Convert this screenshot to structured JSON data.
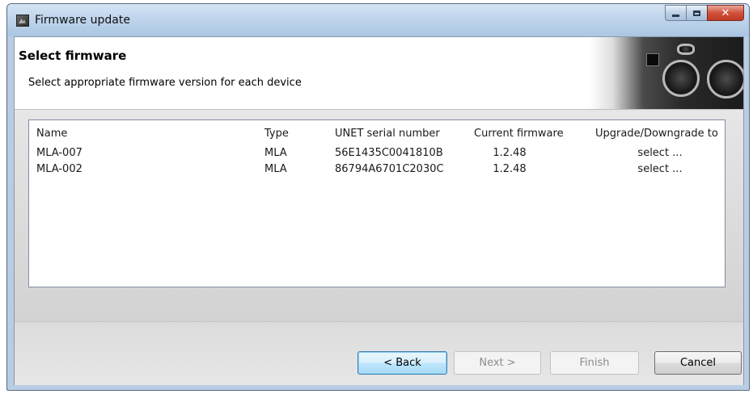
{
  "window": {
    "title": "Firmware update"
  },
  "header": {
    "title": "Select firmware",
    "subtitle": "Select appropriate firmware version for each device"
  },
  "device_list": {
    "columns": [
      "Name",
      "Type",
      "UNET serial number",
      "Current firmware",
      "Upgrade/Downgrade to"
    ],
    "rows": [
      {
        "name": "MLA-007",
        "type": "MLA",
        "serial": "56E1435C0041810B",
        "current": "1.2.48",
        "upgrade": "select ..."
      },
      {
        "name": "MLA-002",
        "type": "MLA",
        "serial": "86794A6701C2030C",
        "current": "1.2.48",
        "upgrade": "select ..."
      }
    ]
  },
  "buttons": {
    "back": "< Back",
    "next": "Next >",
    "finish": "Finish",
    "cancel": "Cancel"
  },
  "icons": {
    "app": "firmware-app-icon",
    "minimize": "minimize-icon",
    "maximize": "maximize-icon",
    "close": "close-icon"
  },
  "colors": {
    "titlebar": "#bfd5ec",
    "close_button": "#c23a22",
    "default_button_border": "#3c7fb1"
  }
}
